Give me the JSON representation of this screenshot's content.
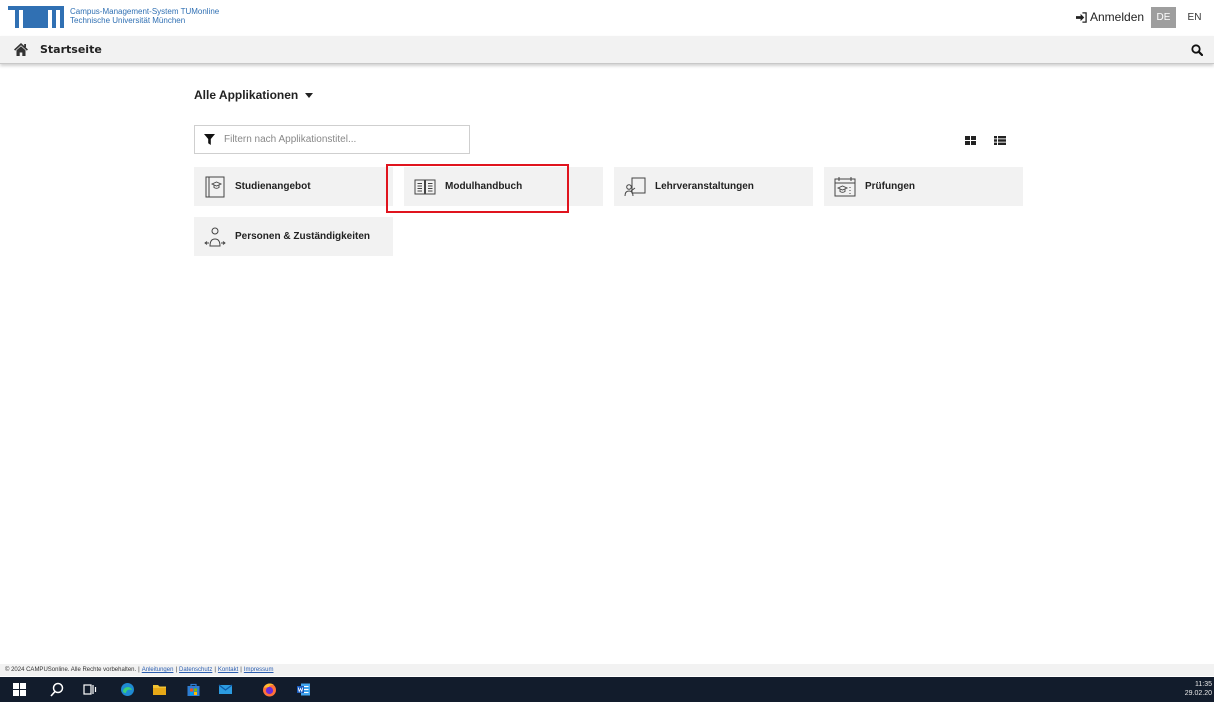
{
  "header": {
    "brand_line1": "Campus-Management-System TUMonline",
    "brand_line2": "Technische Universität München",
    "login_label": "Anmelden",
    "lang_de": "DE",
    "lang_en": "EN",
    "brand_color": "#3070b3"
  },
  "breadcrumb": {
    "home_label": "Startseite"
  },
  "main": {
    "apps_title": "Alle Applikationen",
    "filter_placeholder": "Filtern nach Applikationstitel...",
    "tiles": [
      {
        "label": "Studienangebot",
        "icon": "study-offer-icon"
      },
      {
        "label": "Modulhandbuch",
        "icon": "module-book-icon"
      },
      {
        "label": "Lehrveranstaltungen",
        "icon": "courses-icon"
      },
      {
        "label": "Prüfungen",
        "icon": "exams-icon"
      },
      {
        "label": "Personen & Zuständigkeiten",
        "icon": "persons-icon"
      }
    ],
    "highlight_color": "#e0141e"
  },
  "footer": {
    "copyright": "© 2024 CAMPUSonline. Alle Rechte vorbehalten.",
    "links": [
      "Anleitungen",
      "Datenschutz",
      "Kontakt",
      "Impressum"
    ]
  },
  "taskbar": {
    "time": "11:35",
    "date": "29.02.20"
  }
}
